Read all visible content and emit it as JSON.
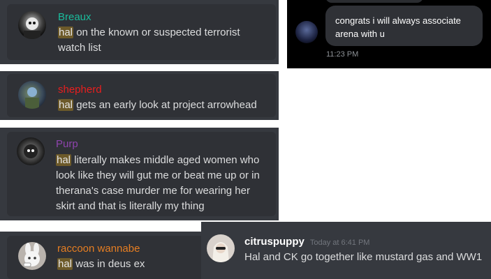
{
  "colors": {
    "breaux": "#1abc9c",
    "shepherd": "#e91e1e",
    "purp": "#8e44ad",
    "raccoon": "#e67e22",
    "citrus": "#ffffff",
    "highlight_bg": "#6d5a2a"
  },
  "messages": [
    {
      "author": "Breaux",
      "highlight": "hal",
      "rest": " on the known or suspected terrorist watch list"
    },
    {
      "author": "shepherd",
      "highlight": "hal",
      "rest": " gets an early look at project arrowhead"
    },
    {
      "author": "Purp",
      "highlight": "hal",
      "rest": " literally makes middle aged women who look like they will gut me or beat me up or in therana's case murder me for wearing her skirt and that is literally my thing"
    },
    {
      "author": "raccoon wannabe",
      "highlight": "hal",
      "rest": " was in deus ex"
    },
    {
      "author": "citruspuppy",
      "timestamp": "Today at 6:41 PM",
      "text": "Hal and CK go together like mustard gas and WW1"
    }
  ],
  "dm": {
    "text": "congrats i will always associate arena with u",
    "time": "11:23 PM"
  },
  "icons": [
    "avatar-breaux",
    "avatar-shepherd",
    "avatar-purp",
    "avatar-raccoon",
    "avatar-citruspuppy",
    "avatar-dm"
  ]
}
